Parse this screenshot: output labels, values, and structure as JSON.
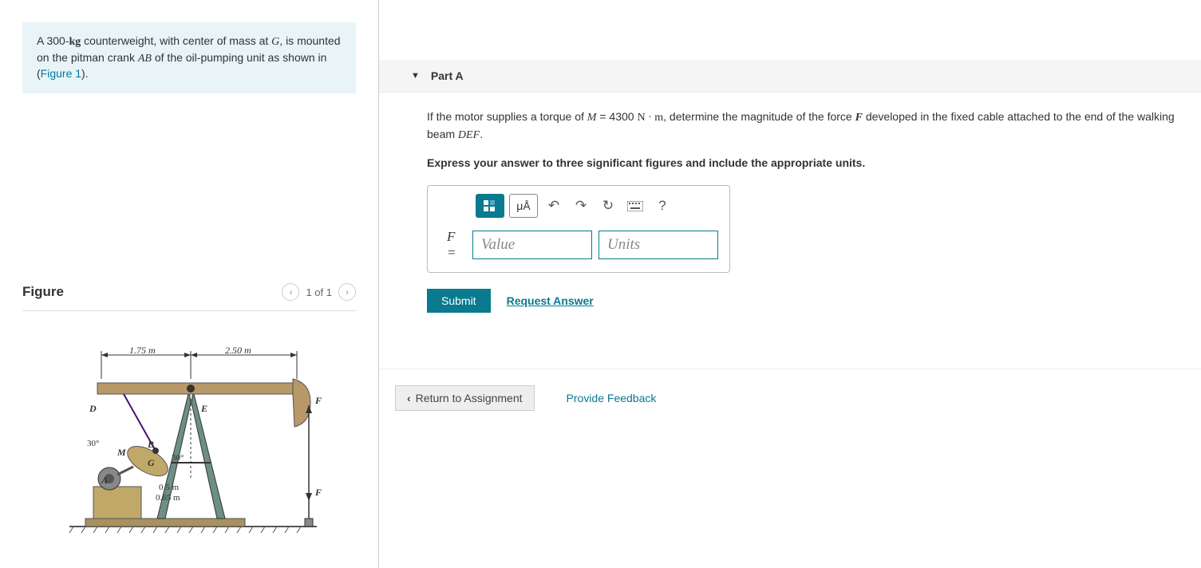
{
  "problem": {
    "text_parts": {
      "p1": "A 300-",
      "kg": "kg",
      "p2": " counterweight, with center of mass at ",
      "G": "G",
      "p3": ", is mounted on the pitman crank ",
      "AB": "AB",
      "p4": " of the oil-pumping unit as shown in (",
      "figlink": "Figure 1",
      "p5": ")."
    }
  },
  "figure": {
    "title": "Figure",
    "nav_text": "1 of 1",
    "labels": {
      "dim1": "1.75 m",
      "dim2": "2.50 m",
      "D": "D",
      "E": "E",
      "F1": "F",
      "F2": "F",
      "M": "M",
      "B": "B",
      "G": "G",
      "A": "A",
      "ang1": "30°",
      "ang2": "30°",
      "dim3": "0.5 m",
      "dim4": "0.65 m"
    }
  },
  "part": {
    "title": "Part A",
    "prompt": {
      "p1": "If the motor supplies a torque of ",
      "M": "M",
      "eq": " = 4300 ",
      "units": "N · m",
      "p2": ", determine the magnitude of the force ",
      "F": "F",
      "p3": " developed in the fixed cable attached to the end of the walking beam ",
      "DEF": "DEF",
      "p4": "."
    },
    "instruction": "Express your answer to three significant figures and include the appropriate units.",
    "toolbar": {
      "units_symbol": "μÅ",
      "help": "?"
    },
    "answer": {
      "label": "F =",
      "value_placeholder": "Value",
      "units_placeholder": "Units"
    },
    "submit": "Submit",
    "request": "Request Answer"
  },
  "bottom": {
    "return": "Return to Assignment",
    "feedback": "Provide Feedback"
  }
}
